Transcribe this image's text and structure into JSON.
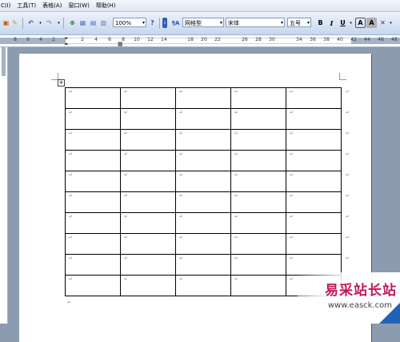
{
  "menubar": {
    "items": [
      "C(I)",
      "工具(T)",
      "表格(A)",
      "窗口(W)",
      "帮助(H)"
    ]
  },
  "toolbar": {
    "zoom": "100%",
    "style": "网格型",
    "font": "宋体",
    "size": "五号",
    "bold": "B",
    "italic": "I",
    "underline": "U",
    "char_border": "A",
    "char_shading": "A"
  },
  "ruler": {
    "labels": [
      "8",
      "6",
      "4",
      "2",
      "2",
      "4",
      "6",
      "8",
      "10",
      "12",
      "14",
      "18",
      "20",
      "22",
      "26",
      "28",
      "30",
      "34",
      "36",
      "38",
      "40",
      "42",
      "44",
      "46",
      "48"
    ]
  },
  "table": {
    "rows": 10,
    "cols": 5,
    "cell_mark": "↵"
  },
  "watermark": {
    "title": "易采站长站",
    "url": "www.easck.com"
  },
  "colors": {
    "appBackground": "#8d9bb0",
    "toolbar": "#c6d6ee",
    "watermark": "#c2185b",
    "corner": "#1e63b8"
  }
}
